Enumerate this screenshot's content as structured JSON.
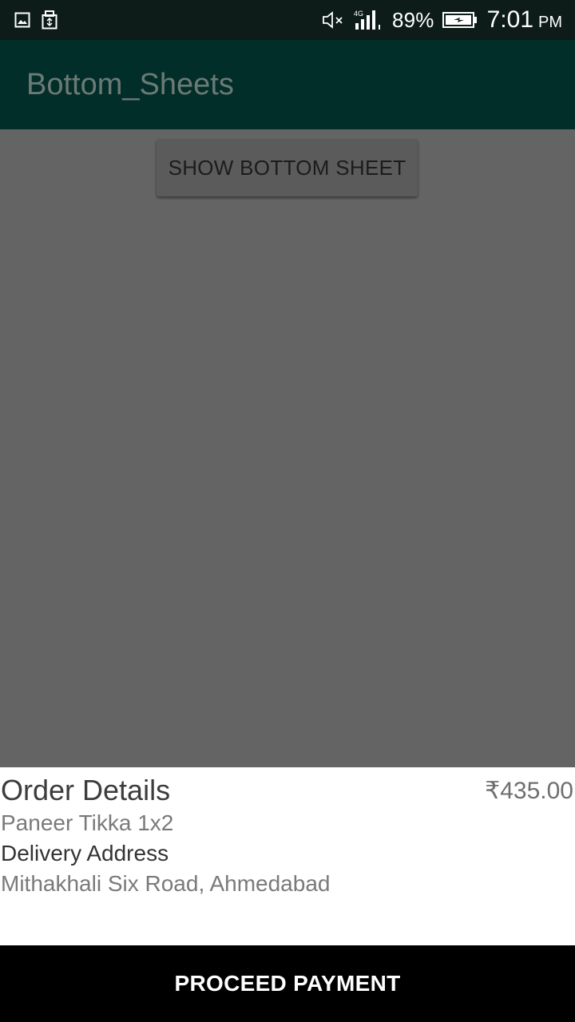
{
  "status_bar": {
    "icons_left": [
      "image-icon",
      "usb-icon"
    ],
    "icons_right": [
      "mute-icon",
      "signal-4g-icon",
      "battery-charging-icon"
    ],
    "network_label": "4G",
    "battery_percent": "89%",
    "time": "7:01",
    "ampm": "PM"
  },
  "app_bar": {
    "title": "Bottom_Sheets"
  },
  "main": {
    "show_button_label": "SHOW BOTTOM SHEET"
  },
  "bottom_sheet": {
    "title": "Order Details",
    "price": "₹435.00",
    "item": "Paneer Tikka 1x2",
    "address_label": "Delivery Address",
    "address_value": "Mithakhali Six Road, Ahmedabad",
    "action_label": "PROCEED PAYMENT"
  },
  "colors": {
    "status_bar_bg": "#0d1c18",
    "app_bar_bg": "#022e29",
    "scrim_bg": "#646464",
    "action_bg": "#000000"
  }
}
